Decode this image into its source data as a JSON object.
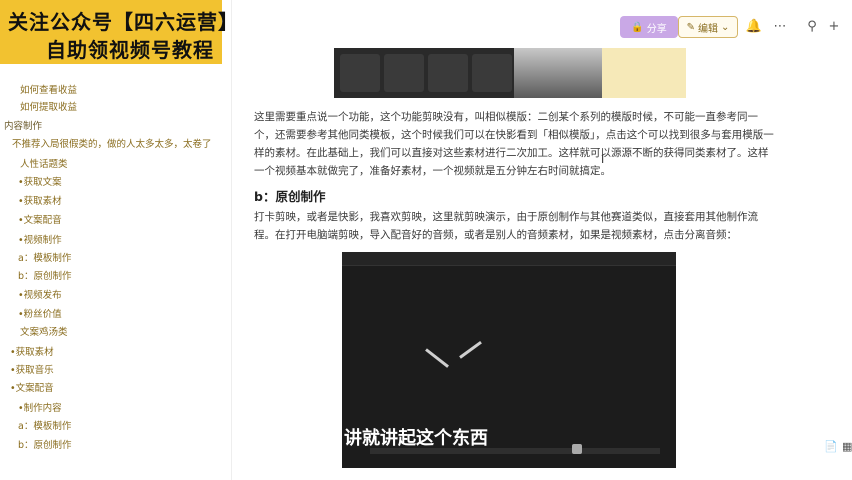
{
  "banner": {
    "line1": "关注公众号【四六运营】",
    "line2": "自助领视频号教程"
  },
  "sidebar": {
    "items": [
      {
        "label": "如何查看收益"
      },
      {
        "label": "如何提取收益"
      },
      {
        "label": "内容制作"
      },
      {
        "label": "不推荐入局很假类的，做的人太多太多，太卷了"
      },
      {
        "label": "人性话题类"
      },
      {
        "label": "•获取文案"
      },
      {
        "label": "•获取素材"
      },
      {
        "label": "•文案配音"
      },
      {
        "label": "•视频制作"
      },
      {
        "label": "a：模板制作"
      },
      {
        "label": "b：原创制作"
      },
      {
        "label": "•视频发布"
      },
      {
        "label": "•粉丝价值"
      },
      {
        "label": "文案鸡汤类"
      },
      {
        "label": "•获取素材"
      },
      {
        "label": "•获取音乐"
      },
      {
        "label": "•文案配音"
      },
      {
        "label": "•制作内容"
      },
      {
        "label": "a：模板制作"
      },
      {
        "label": "b：原创制作"
      }
    ]
  },
  "topbar": {
    "share_label": "分享",
    "edit_label": "编辑",
    "icons": [
      "bell-icon",
      "more-icon",
      "search-icon",
      "plus-icon"
    ]
  },
  "content": {
    "para1": "这里需要重点说一个功能，这个功能剪映没有，叫相似模版：二创某个系列的模版时候，不可能一直参考同一个，还需要参考其他同类模板，这个时候我们可以在快影看到「相似模版」，点击这个可以找到很多与套用模版一样的素材。在此基础上，我们可以直接对这些素材进行二次加工。这样就可以源源不断的获得同类素材了。这样一个视频基本就做完了，准备好素材，一个视频就是五分钟左右时间就搞定。",
    "heading": "b：原创制作",
    "para2": "打卡剪映，或者是快影，我喜欢剪映，这里就剪映演示，由于原创制作与其他赛道类似，直接套用其他制作流程。在打开电脑端剪映，导入配音好的音频，或者是别人的音频素材，如果是视频素材，点击分离音频：",
    "video_subtitle": "讲就讲起这个东西"
  },
  "colors": {
    "banner_bg": "#f2c230",
    "accent": "#8a6d1f",
    "share_bg": "#c9a8e6"
  }
}
